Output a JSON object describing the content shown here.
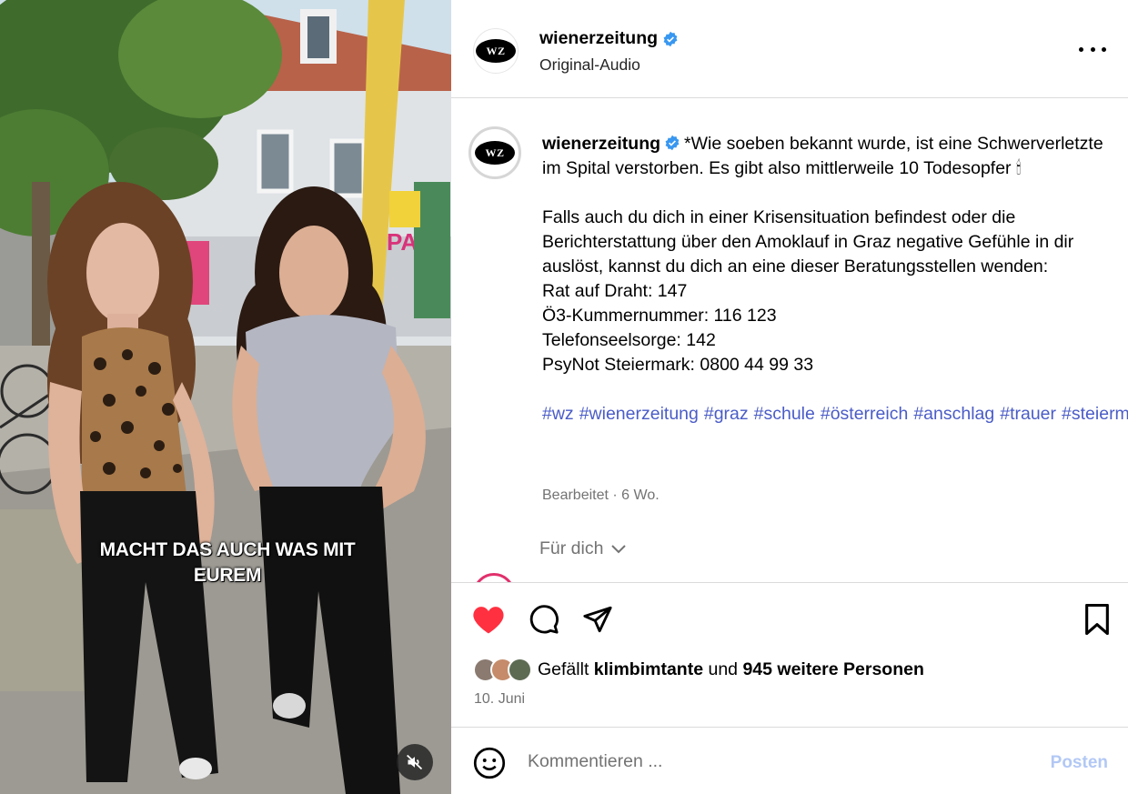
{
  "video": {
    "caption_line1": "MACHT DAS AUCH WAS MIT",
    "caption_line2": "EUREM",
    "storefront_sign": "PA",
    "mute_icon": "speaker-muted-icon"
  },
  "header": {
    "username": "wienerzeitung",
    "audio": "Original-Audio",
    "avatar_text": "WZ",
    "verified_color": "#3897f0"
  },
  "caption": {
    "username": "wienerzeitung",
    "avatar_text": "WZ",
    "text_part1": "*Wie soeben bekannt wurde, ist eine Schwerverletzte im Spital verstorben. Es gibt also mittlerweile 10 Todesopfer",
    "candle": "🕯",
    "text_part2": "Falls auch du dich in einer Krisensituation befindest oder die Berichterstattung über den Amoklauf in Graz negative Gefühle in dir auslöst, kannst du dich an eine dieser Beratungsstellen wenden:\nRat auf Draht: 147\nÖ3-Kummernummer: 116 123\nTelefonseelsorge: 142\nPsyNot Steiermark: 0800 44 99 33",
    "hashtags": [
      "#wz",
      "#wienerzeitung",
      "#graz",
      "#schule",
      "#österreich",
      "#anschlag",
      "#trauer",
      "#steiermark"
    ],
    "meta": "Bearbeitet · 6 Wo.",
    "for_you": "Für dich"
  },
  "actions": {
    "like_color": "#ff3040",
    "liked_by_prefix": "Gefällt",
    "liked_by_user": "klimbimtante",
    "liked_by_middle": "und",
    "liked_by_others": "945 weitere Personen",
    "date": "10. Juni"
  },
  "comment": {
    "placeholder": "Kommentieren ...",
    "post_label": "Posten"
  }
}
